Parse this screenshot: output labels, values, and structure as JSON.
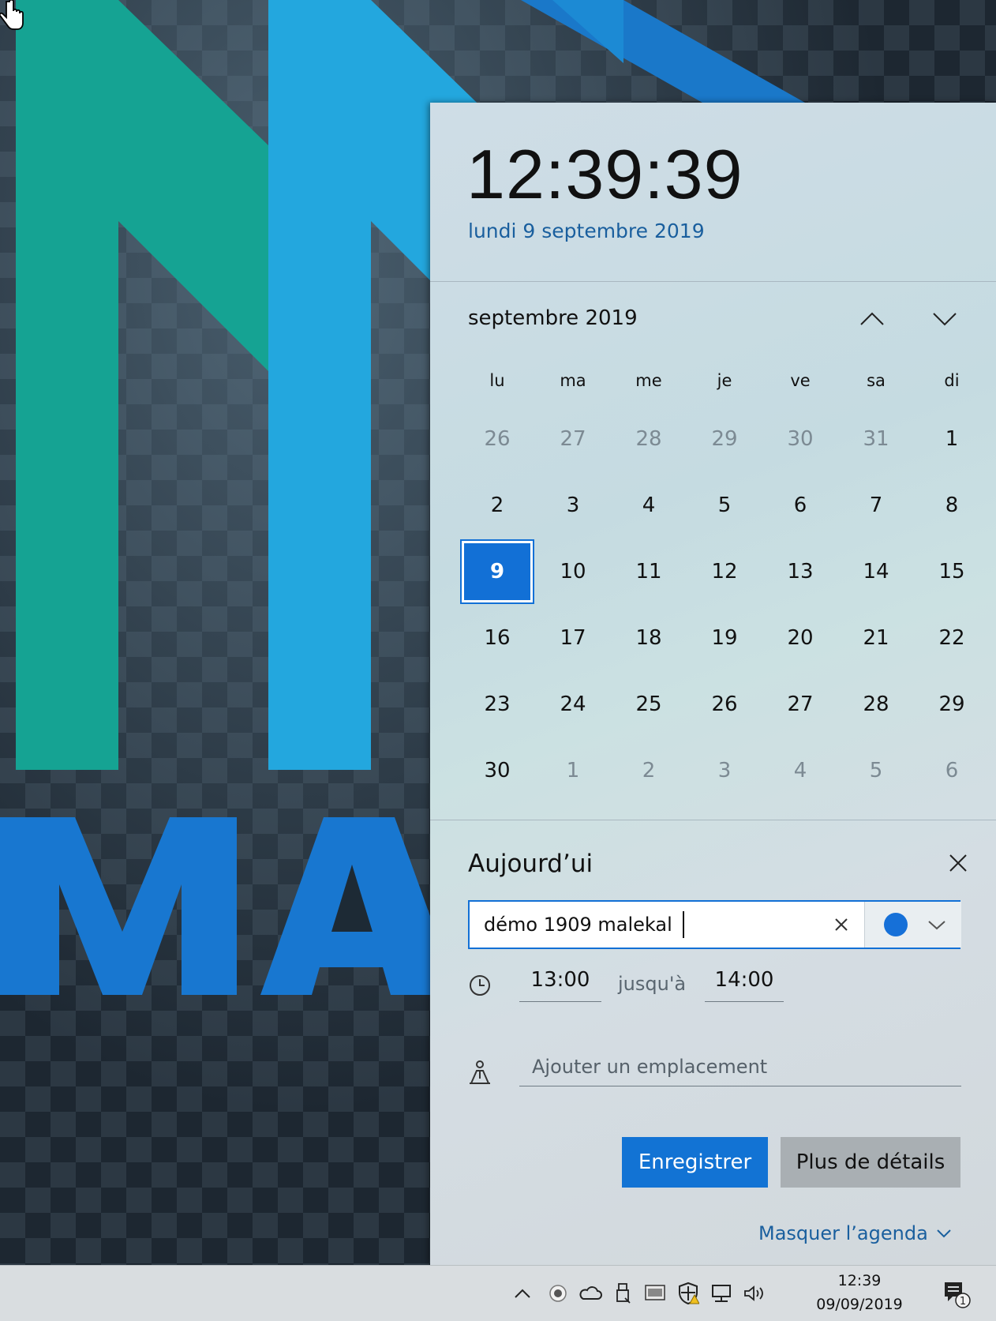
{
  "flyout": {
    "time": "12:39:39",
    "long_date": "lundi 9 septembre 2019",
    "month_label": "septembre 2019",
    "weekdays": [
      "lu",
      "ma",
      "me",
      "je",
      "ve",
      "sa",
      "di"
    ],
    "weeks": [
      [
        "26",
        "27",
        "28",
        "29",
        "30",
        "31",
        "1"
      ],
      [
        "2",
        "3",
        "4",
        "5",
        "6",
        "7",
        "8"
      ],
      [
        "9",
        "10",
        "11",
        "12",
        "13",
        "14",
        "15"
      ],
      [
        "16",
        "17",
        "18",
        "19",
        "20",
        "21",
        "22"
      ],
      [
        "23",
        "24",
        "25",
        "26",
        "27",
        "28",
        "29"
      ],
      [
        "30",
        "1",
        "2",
        "3",
        "4",
        "5",
        "6"
      ]
    ],
    "selected_day": "9",
    "agenda": {
      "title": "Aujourd’ui",
      "event_value": "démo 1909 malekal",
      "event_color": "#1670d8",
      "start_time": "13:00",
      "until_label": "jusqu'à",
      "end_time": "14:00",
      "location_placeholder": "Ajouter un emplacement",
      "save_label": "Enregistrer",
      "more_details_label": "Plus de détails",
      "hide_agenda_label": "Masquer l’agenda"
    },
    "accent_color": "#1270d6"
  },
  "taskbar": {
    "time": "12:39",
    "date": "09/09/2019",
    "notification_count": "1"
  },
  "desktop": {
    "wallpaper_text": "MAL"
  }
}
